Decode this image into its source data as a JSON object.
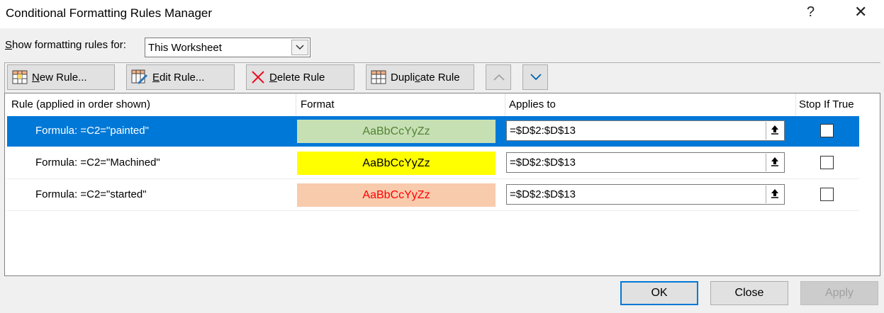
{
  "window": {
    "title": "Conditional Formatting Rules Manager",
    "help_icon": "?",
    "close_icon": "✕"
  },
  "filter": {
    "label_prefix": "S",
    "label_rest": "how formatting rules for:",
    "selected": "This Worksheet"
  },
  "toolbar": {
    "new_rule_u": "N",
    "new_rule_rest": "ew Rule...",
    "edit_rule_u": "E",
    "edit_rule_rest": "dit Rule...",
    "delete_rule_u": "D",
    "delete_rule_rest": "elete Rule",
    "duplicate_rule_pre": "Dupli",
    "duplicate_rule_u": "c",
    "duplicate_rule_rest": "ate Rule"
  },
  "columns": {
    "rule": "Rule (applied in order shown)",
    "format": "Format",
    "applies_to": "Applies to",
    "stop_if_true": "Stop If True"
  },
  "rules": [
    {
      "rule": "Formula: =C2=\"painted\"",
      "preview": "AaBbCcYyZz",
      "bg": "#c6e0b4",
      "fg": "#548235",
      "applies_to": "=$D$2:$D$13",
      "stop": false
    },
    {
      "rule": "Formula: =C2=\"Machined\"",
      "preview": "AaBbCcYyZz",
      "bg": "#ffff00",
      "fg": "#000000",
      "applies_to": "=$D$2:$D$13",
      "stop": false
    },
    {
      "rule": "Formula: =C2=\"started\"",
      "preview": "AaBbCcYyZz",
      "bg": "#f8cbad",
      "fg": "#ff0000",
      "applies_to": "=$D$2:$D$13",
      "stop": false
    }
  ],
  "buttons": {
    "ok": "OK",
    "close": "Close",
    "apply": "Apply"
  }
}
